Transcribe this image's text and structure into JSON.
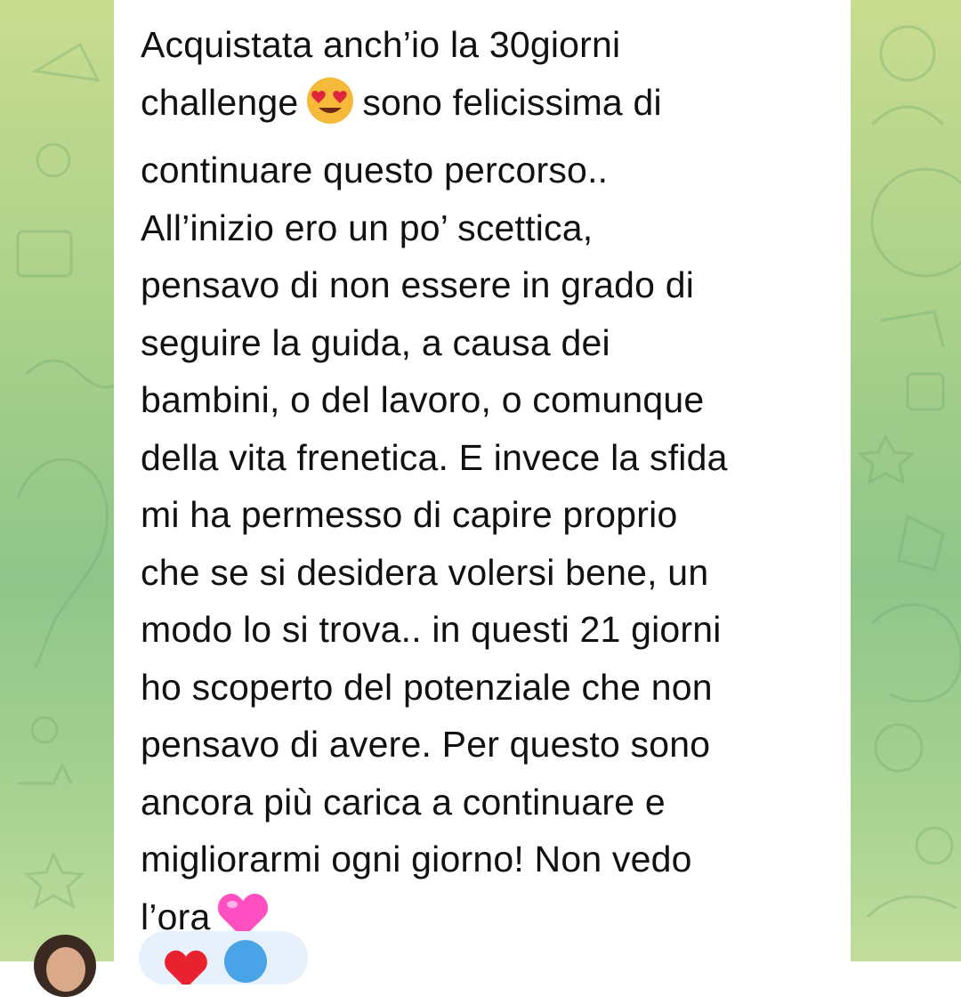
{
  "message": {
    "lines": [
      "Acquistata anch’io la 30giorni",
      "challenge",
      "sono felicissima di",
      "continuare questo percorso..",
      "All’inizio ero un po’ scettica,",
      "pensavo di non essere in grado di",
      "seguire la guida, a causa dei",
      "bambini, o del lavoro, o comunque",
      "della vita frenetica. E invece la sfida",
      "mi ha permesso di capire proprio",
      "che se si desidera volersi bene, un",
      "modo lo si trova.. in questi 21 giorni",
      "ho scoperto del potenziale che non",
      "pensavo di avere. Per questo sono",
      "ancora più carica a continuare e",
      "migliorarmi ogni giorno! Non vedo",
      "l’ora"
    ],
    "emoji_heart_eyes": "heart-eyes-emoji",
    "emoji_pink_heart": "pink-heart-emoji"
  },
  "reactions": {
    "icon": "red-heart-icon",
    "reactor": "reactor-avatar"
  },
  "sender": {
    "avatar": "sender-avatar"
  },
  "colors": {
    "bubble": "#ffffff",
    "text": "#111111",
    "background_green": "#8fc58a",
    "reaction_pill": "#e7f1fb"
  }
}
